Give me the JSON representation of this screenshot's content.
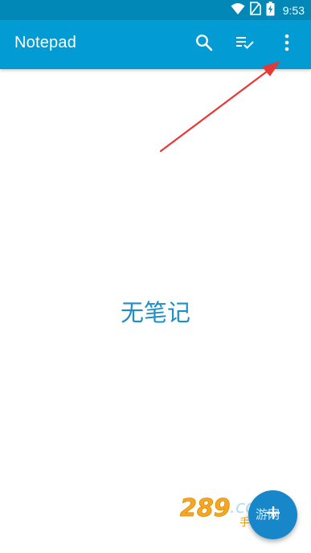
{
  "status_bar": {
    "time": "9:53",
    "icons": [
      "wifi-icon",
      "no-sim-icon",
      "battery-charging-icon"
    ],
    "color": "#0288b7"
  },
  "app_bar": {
    "title": "Notepad",
    "color": "#039bd3",
    "actions": [
      "search-icon",
      "select-list-icon",
      "more-vert-icon"
    ]
  },
  "main": {
    "empty_text": "无笔记",
    "empty_text_color": "#1d8fc6"
  },
  "fab": {
    "icon": "add-icon",
    "color": "#1787c9"
  },
  "annotation": {
    "type": "red-arrow",
    "color": "#e53935",
    "points_to": "more-vert-icon"
  },
  "watermark": {
    "text": "289.com 手游网"
  }
}
